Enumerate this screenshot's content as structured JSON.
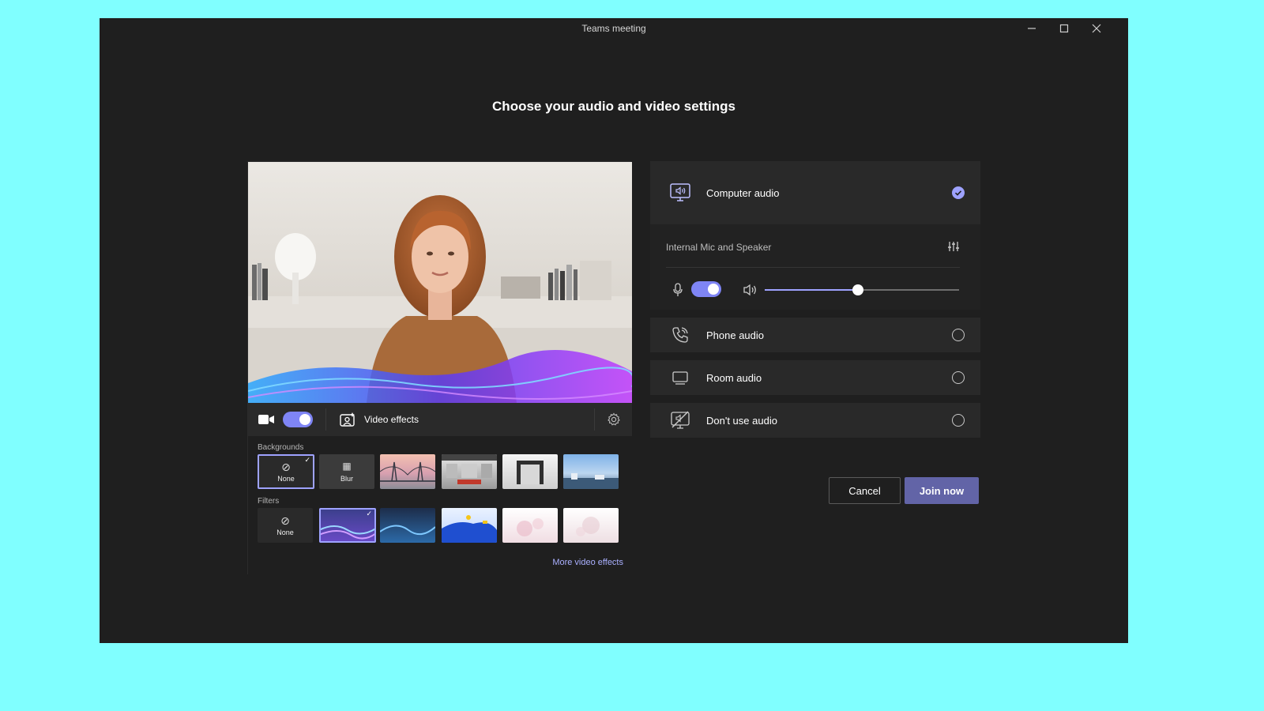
{
  "window": {
    "title": "Teams meeting",
    "controls": [
      "minimize",
      "maximize",
      "close"
    ]
  },
  "heading": "Choose your audio and video settings",
  "video": {
    "camera_enabled": true,
    "video_effects_label": "Video effects",
    "backgrounds_label": "Backgrounds",
    "backgrounds": [
      {
        "label": "None",
        "selected": true
      },
      {
        "label": "Blur",
        "selected": false
      },
      {
        "label": "",
        "selected": false
      },
      {
        "label": "",
        "selected": false
      },
      {
        "label": "",
        "selected": false
      },
      {
        "label": "",
        "selected": false
      }
    ],
    "filters_label": "Filters",
    "filters": [
      {
        "label": "None",
        "selected": false
      },
      {
        "label": "",
        "selected": true
      },
      {
        "label": "",
        "selected": false
      },
      {
        "label": "",
        "selected": false
      },
      {
        "label": "",
        "selected": false
      },
      {
        "label": "",
        "selected": false
      }
    ],
    "more_effects_label": "More video effects"
  },
  "audio": {
    "options": [
      {
        "label": "Computer audio",
        "selected": true
      },
      {
        "label": "Phone audio",
        "selected": false
      },
      {
        "label": "Room audio",
        "selected": false
      },
      {
        "label": "Don't use audio",
        "selected": false
      }
    ],
    "device_name": "Internal Mic and Speaker",
    "mic_enabled": true,
    "speaker_volume": 0.48
  },
  "actions": {
    "cancel_label": "Cancel",
    "join_label": "Join now"
  },
  "colors": {
    "accent": "#6264a7",
    "accent_light": "#9ea2ff",
    "background": "#1f1f1f",
    "desktop": "#80ffff"
  }
}
